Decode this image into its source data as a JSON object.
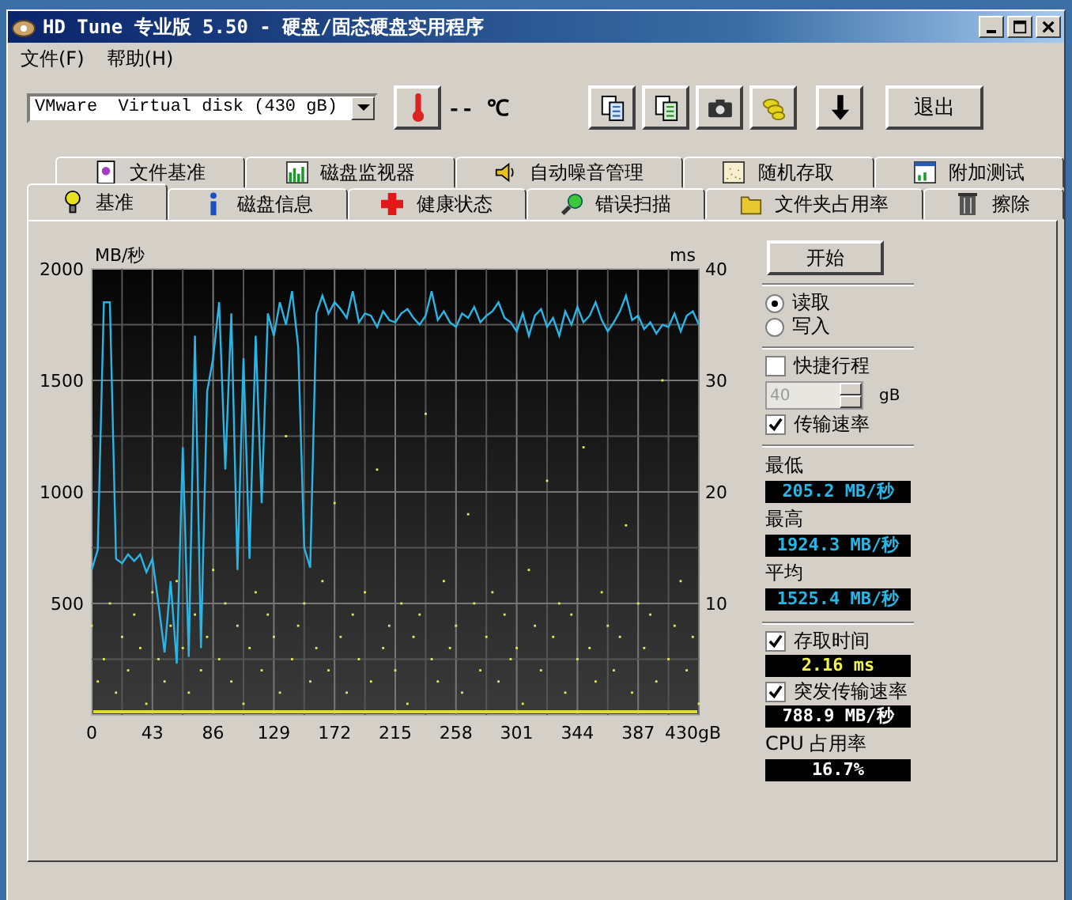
{
  "window": {
    "title": "HD Tune 专业版 5.50 - 硬盘/固态硬盘实用程序"
  },
  "menu": [
    {
      "label": "文件(F)"
    },
    {
      "label": "帮助(H)"
    }
  ],
  "toolbar": {
    "drive": "VMware  Virtual disk (430 gB)",
    "temperature": "-- ℃",
    "exit": "退出"
  },
  "tabs_back": [
    {
      "label": "文件基准",
      "selected": false
    },
    {
      "label": "磁盘监视器",
      "selected": false
    },
    {
      "label": "自动噪音管理",
      "selected": false
    },
    {
      "label": "随机存取",
      "selected": false
    },
    {
      "label": "附加测试",
      "selected": false
    }
  ],
  "tabs_front": [
    {
      "label": "基准",
      "selected": true
    },
    {
      "label": "磁盘信息",
      "selected": false
    },
    {
      "label": "健康状态",
      "selected": false
    },
    {
      "label": "错误扫描",
      "selected": false
    },
    {
      "label": "文件夹占用率",
      "selected": false
    },
    {
      "label": "擦除",
      "selected": false
    }
  ],
  "chart": {
    "chart_data": {
      "type": "line",
      "grid": true,
      "ylabel": "MB/秒",
      "y2label": "ms",
      "y2lim": [
        0,
        40
      ],
      "y2ticks": [
        10,
        20,
        30,
        40
      ],
      "xlim": [
        0,
        430
      ],
      "ylim": [
        0,
        2000
      ],
      "yticks": [
        500,
        1000,
        1500,
        2000
      ],
      "xticks": [
        0,
        43,
        86,
        129,
        172,
        215,
        258,
        301,
        344,
        387,
        {
          "value": 430,
          "label": "430gB"
        }
      ],
      "x": [
        0,
        4.3,
        8.6,
        12.9,
        17.2,
        21.5,
        25.8,
        30.1,
        34.4,
        38.7,
        43,
        47.3,
        51.6,
        55.9,
        60.2,
        64.5,
        68.8,
        73.1,
        77.4,
        81.7,
        86,
        90.3,
        94.6,
        98.9,
        103.2,
        107.5,
        111.8,
        116.1,
        120.4,
        124.7,
        129,
        133.3,
        137.6,
        141.9,
        146.2,
        150.5,
        154.8,
        159.1,
        163.4,
        167.7,
        172,
        176.3,
        180.6,
        184.9,
        189.2,
        193.5,
        197.8,
        202.1,
        206.4,
        210.7,
        215,
        219.3,
        223.6,
        227.9,
        232.2,
        236.5,
        240.8,
        245.1,
        249.4,
        253.7,
        258,
        262.3,
        266.6,
        270.9,
        275.2,
        279.5,
        283.8,
        288.1,
        292.4,
        296.7,
        301,
        305.3,
        309.6,
        313.9,
        318.2,
        322.5,
        326.8,
        331.1,
        335.4,
        339.7,
        344,
        348.3,
        352.6,
        356.9,
        361.2,
        365.5,
        369.8,
        374.1,
        378.4,
        382.7,
        387,
        391.3,
        395.6,
        399.9,
        404.2,
        408.5,
        412.8,
        417.1,
        421.4,
        425.7,
        430
      ],
      "series": [
        {
          "color": "#29b6e6",
          "values": [
            650,
            740,
            1850,
            1850,
            700,
            680,
            720,
            690,
            720,
            640,
            700,
            500,
            280,
            600,
            230,
            1200,
            260,
            1700,
            300,
            1450,
            1600,
            1850,
            1100,
            1800,
            650,
            1600,
            700,
            1700,
            950,
            1800,
            1700,
            1850,
            1750,
            1900,
            1650,
            750,
            660,
            1800,
            1880,
            1800,
            1850,
            1820,
            1780,
            1900,
            1760,
            1800,
            1790,
            1740,
            1810,
            1770,
            1760,
            1800,
            1820,
            1780,
            1750,
            1790,
            1900,
            1770,
            1810,
            1760,
            1740,
            1800,
            1780,
            1830,
            1760,
            1790,
            1810,
            1850,
            1780,
            1760,
            1720,
            1800,
            1700,
            1790,
            1820,
            1740,
            1780,
            1700,
            1810,
            1750,
            1830,
            1760,
            1790,
            1850,
            1770,
            1720,
            1760,
            1810,
            1880,
            1770,
            1790,
            1730,
            1760,
            1710,
            1750,
            1740,
            1800,
            1720,
            1790,
            1810,
            1750
          ]
        },
        {
          "color": "#e8e860",
          "axis": "y2",
          "type": "scatter",
          "values": [
            8,
            3,
            5,
            10,
            2,
            7,
            4,
            9,
            6,
            1,
            11,
            5,
            3,
            8,
            12,
            6,
            2,
            9,
            4,
            7,
            13,
            5,
            10,
            3,
            8,
            1,
            6,
            11,
            4,
            9,
            7,
            2,
            25,
            5,
            8,
            10,
            3,
            6,
            12,
            4,
            19,
            7,
            2,
            9,
            5,
            11,
            3,
            22,
            6,
            8,
            4,
            10,
            1,
            7,
            9,
            27,
            5,
            3,
            12,
            6,
            8,
            2,
            18,
            10,
            4,
            7,
            11,
            3,
            9,
            5,
            6,
            1,
            13,
            8,
            4,
            21,
            7,
            10,
            2,
            9,
            5,
            24,
            6,
            3,
            11,
            8,
            4,
            7,
            17,
            2,
            10,
            6,
            9,
            3,
            30,
            5,
            8,
            12,
            4,
            7,
            1
          ]
        }
      ]
    }
  },
  "start_button": "开始",
  "mode": [
    {
      "label": "读取",
      "selected": true
    },
    {
      "label": "写入",
      "selected": false
    }
  ],
  "short_stroke": {
    "label": "快捷行程",
    "checked": false,
    "value": "40",
    "unit": "gB"
  },
  "transfer_rate": {
    "label": "传输速率",
    "checked": true,
    "stats": [
      {
        "label": "最低",
        "value": "205.2 MB/秒"
      },
      {
        "label": "最高",
        "value": "1924.3 MB/秒"
      },
      {
        "label": "平均",
        "value": "1525.4 MB/秒"
      }
    ]
  },
  "access_time": {
    "label": "存取时间",
    "checked": true,
    "value": "2.16 ms"
  },
  "burst_rate": {
    "label": "突发传输速率",
    "checked": true,
    "value": "788.9 MB/秒"
  },
  "cpu": {
    "label": "CPU 占用率",
    "value": "16.7%"
  }
}
